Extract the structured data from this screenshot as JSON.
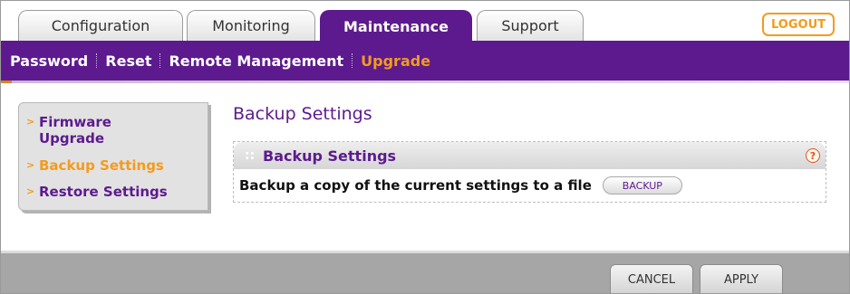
{
  "tabs": [
    {
      "label": "Configuration"
    },
    {
      "label": "Monitoring"
    },
    {
      "label": "Maintenance"
    },
    {
      "label": "Support"
    }
  ],
  "logout_label": "LOGOUT",
  "subnav": [
    {
      "label": "Password"
    },
    {
      "label": "Reset"
    },
    {
      "label": "Remote Management"
    },
    {
      "label": "Upgrade"
    }
  ],
  "sidemenu": [
    {
      "label": "Firmware Upgrade"
    },
    {
      "label": "Backup Settings"
    },
    {
      "label": "Restore Settings"
    }
  ],
  "page_title": "Backup Settings",
  "section": {
    "title": "Backup Settings",
    "help_symbol": "?",
    "backup_text": "Backup a copy of the current settings to a file",
    "backup_button": "BACKUP"
  },
  "footer": {
    "cancel_label": "CANCEL",
    "apply_label": "APPLY"
  },
  "colors": {
    "brand_purple": "#5d1a8e",
    "accent_orange": "#f39b1e",
    "footer_gray": "#a6a6a6"
  }
}
